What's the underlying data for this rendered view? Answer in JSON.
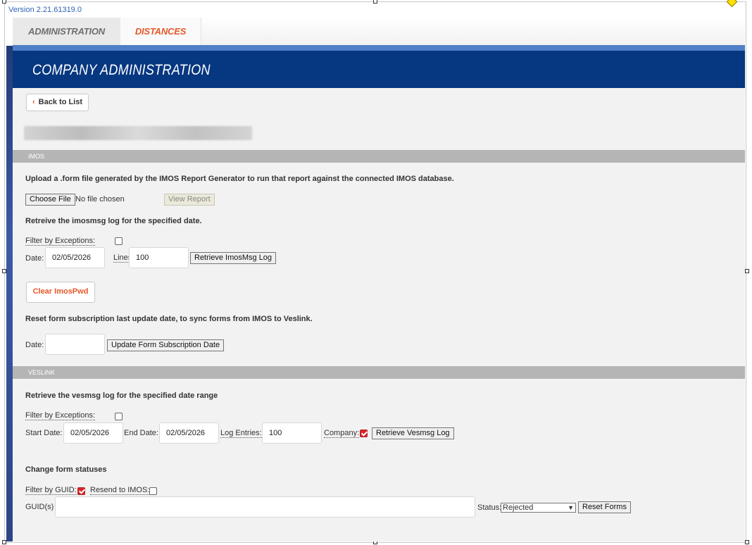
{
  "version": "Version 2.21.61319.0",
  "nav": {
    "tabs": [
      "ADMINISTRATION",
      "DISTANCES"
    ]
  },
  "banner": {
    "title": "COMPANY ADMINISTRATION"
  },
  "back_button": "Back to List",
  "imos": {
    "section_title": "IMOS",
    "upload_text": "Upload a .form file generated by the IMOS Report Generator to run that report against the connected IMOS database.",
    "choose_file": "Choose File",
    "no_file": "No file chosen",
    "view_report": "View Report",
    "retrieve_text": "Retreive the imosmsg log for the specified date.",
    "filter_exceptions_label": "Filter by Exceptions:",
    "date_label": "Date:",
    "date_value": "02/05/2026",
    "lines_label": "Lines:",
    "lines_value": "100",
    "retrieve_button": "Retrieve ImosMsg Log",
    "clear_button": "Clear ImosPwd",
    "reset_text": "Reset form subscription last update date, to sync forms from IMOS to Veslink.",
    "sub_date_label": "Date:",
    "sub_date_value": "",
    "update_button": "Update Form Subscription Date"
  },
  "veslink": {
    "section_title": "VESLINK",
    "retrieve_text": "Retrieve the vesmsg log for the specified date range",
    "filter_exceptions_label": "Filter by Exceptions:",
    "start_date_label": "Start Date:",
    "start_date_value": "02/05/2026",
    "end_date_label": "End Date:",
    "end_date_value": "02/05/2026",
    "log_entries_label": "Log Entries:",
    "log_entries_value": "100",
    "company_label": "Company:",
    "company_checked": true,
    "retrieve_button": "Retrieve Vesmsg Log",
    "change_text": "Change form statuses",
    "filter_guid_label": "Filter by GUID:",
    "filter_guid_checked": true,
    "resend_label": "Resend to IMOS:",
    "resend_checked": false,
    "guids_label": "GUID(s)",
    "guids_value": "",
    "status_label": "Status:",
    "status_value": "Rejected",
    "reset_button": "Reset Forms"
  },
  "colors": {
    "accent": "#e8582a",
    "banner": "#063781",
    "link": "#2f64b8"
  }
}
